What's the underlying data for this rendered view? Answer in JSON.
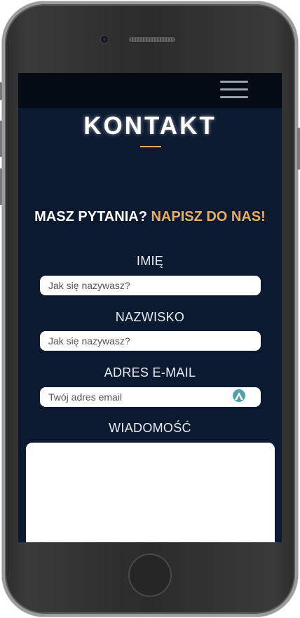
{
  "header": {
    "menu_icon": "hamburger-icon"
  },
  "page": {
    "title": "KONTAKT",
    "subheading_white": "MASZ PYTANIA?",
    "subheading_accent": "NAPISZ DO NAS!",
    "accent_color": "#e8ad63",
    "background_color": "#0c1a31"
  },
  "form": {
    "first_name": {
      "label": "IMIĘ",
      "placeholder": "Jak się nazywasz?"
    },
    "last_name": {
      "label": "NAZWISKO",
      "placeholder": "Jak się nazywasz?"
    },
    "email": {
      "label": "ADRES E-MAIL",
      "placeholder": "Twój adres email",
      "icon": "autofill-icon"
    },
    "message": {
      "label": "WIADOMOŚĆ",
      "placeholder": ""
    }
  }
}
